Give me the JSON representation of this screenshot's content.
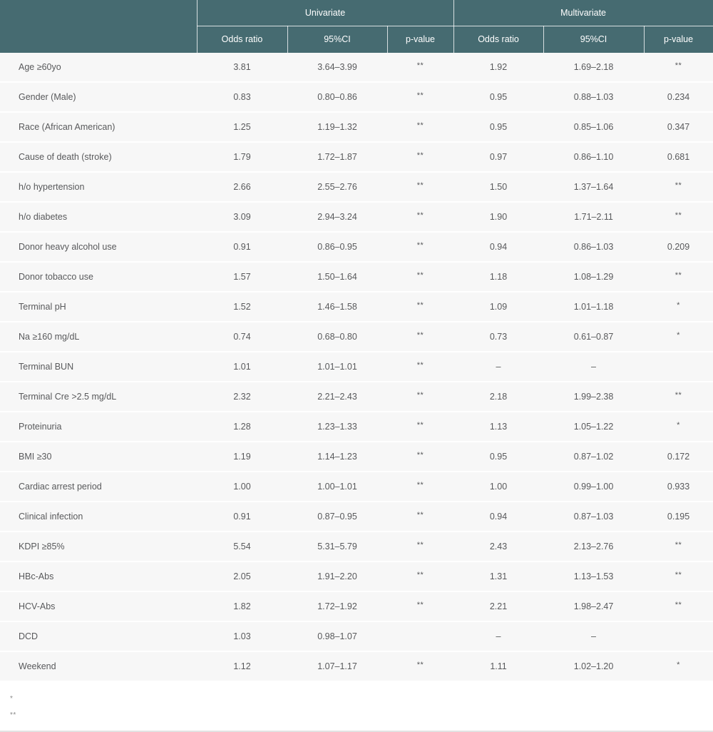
{
  "table": {
    "header": {
      "row_label_col": "",
      "groups": [
        {
          "label": "Univariate",
          "span": 3
        },
        {
          "label": "Multivariate",
          "span": 3
        }
      ],
      "subheaders": [
        "Odds ratio",
        "95%CI",
        "p-value",
        "Odds ratio",
        "95%CI",
        "p-value"
      ]
    },
    "rows": [
      {
        "label": "Age ≥60yo",
        "uni_or": "3.81",
        "uni_ci": "3.64–3.99",
        "uni_p": "**",
        "multi_or": "1.92",
        "multi_ci": "1.69–2.18",
        "multi_p": "**"
      },
      {
        "label": "Gender (Male)",
        "uni_or": "0.83",
        "uni_ci": "0.80–0.86",
        "uni_p": "**",
        "multi_or": "0.95",
        "multi_ci": "0.88–1.03",
        "multi_p": "0.234"
      },
      {
        "label": "Race (African American)",
        "uni_or": "1.25",
        "uni_ci": "1.19–1.32",
        "uni_p": "**",
        "multi_or": "0.95",
        "multi_ci": "0.85–1.06",
        "multi_p": "0.347"
      },
      {
        "label": "Cause of death (stroke)",
        "uni_or": "1.79",
        "uni_ci": "1.72–1.87",
        "uni_p": "**",
        "multi_or": "0.97",
        "multi_ci": "0.86–1.10",
        "multi_p": "0.681"
      },
      {
        "label": "h/o hypertension",
        "uni_or": "2.66",
        "uni_ci": "2.55–2.76",
        "uni_p": "**",
        "multi_or": "1.50",
        "multi_ci": "1.37–1.64",
        "multi_p": "**"
      },
      {
        "label": "h/o diabetes",
        "uni_or": "3.09",
        "uni_ci": "2.94–3.24",
        "uni_p": "**",
        "multi_or": "1.90",
        "multi_ci": "1.71–2.11",
        "multi_p": "**"
      },
      {
        "label": "Donor heavy alcohol use",
        "uni_or": "0.91",
        "uni_ci": "0.86–0.95",
        "uni_p": "**",
        "multi_or": "0.94",
        "multi_ci": "0.86–1.03",
        "multi_p": "0.209"
      },
      {
        "label": "Donor tobacco use",
        "uni_or": "1.57",
        "uni_ci": "1.50–1.64",
        "uni_p": "**",
        "multi_or": "1.18",
        "multi_ci": "1.08–1.29",
        "multi_p": "**"
      },
      {
        "label": "Terminal pH",
        "uni_or": "1.52",
        "uni_ci": "1.46–1.58",
        "uni_p": "**",
        "multi_or": "1.09",
        "multi_ci": "1.01–1.18",
        "multi_p": "*"
      },
      {
        "label": "Na ≥160 mg/dL",
        "uni_or": "0.74",
        "uni_ci": "0.68–0.80",
        "uni_p": "**",
        "multi_or": "0.73",
        "multi_ci": "0.61–0.87",
        "multi_p": "*"
      },
      {
        "label": "Terminal BUN",
        "uni_or": "1.01",
        "uni_ci": "1.01–1.01",
        "uni_p": "**",
        "multi_or": "–",
        "multi_ci": "–",
        "multi_p": ""
      },
      {
        "label": "Terminal Cre >2.5 mg/dL",
        "uni_or": "2.32",
        "uni_ci": "2.21–2.43",
        "uni_p": "**",
        "multi_or": "2.18",
        "multi_ci": "1.99–2.38",
        "multi_p": "**"
      },
      {
        "label": "Proteinuria",
        "uni_or": "1.28",
        "uni_ci": "1.23–1.33",
        "uni_p": "**",
        "multi_or": "1.13",
        "multi_ci": "1.05–1.22",
        "multi_p": "*"
      },
      {
        "label": "BMI ≥30",
        "uni_or": "1.19",
        "uni_ci": "1.14–1.23",
        "uni_p": "**",
        "multi_or": "0.95",
        "multi_ci": "0.87–1.02",
        "multi_p": "0.172"
      },
      {
        "label": "Cardiac arrest period",
        "uni_or": "1.00",
        "uni_ci": "1.00–1.01",
        "uni_p": "**",
        "multi_or": "1.00",
        "multi_ci": "0.99–1.00",
        "multi_p": "0.933"
      },
      {
        "label": "Clinical infection",
        "uni_or": "0.91",
        "uni_ci": "0.87–0.95",
        "uni_p": "**",
        "multi_or": "0.94",
        "multi_ci": "0.87–1.03",
        "multi_p": "0.195"
      },
      {
        "label": "KDPI ≥85%",
        "uni_or": "5.54",
        "uni_ci": "5.31–5.79",
        "uni_p": "**",
        "multi_or": "2.43",
        "multi_ci": "2.13–2.76",
        "multi_p": "**"
      },
      {
        "label": "HBc-Abs",
        "uni_or": "2.05",
        "uni_ci": "1.91–2.20",
        "uni_p": "**",
        "multi_or": "1.31",
        "multi_ci": "1.13–1.53",
        "multi_p": "**"
      },
      {
        "label": "HCV-Abs",
        "uni_or": "1.82",
        "uni_ci": "1.72–1.92",
        "uni_p": "**",
        "multi_or": "2.21",
        "multi_ci": "1.98–2.47",
        "multi_p": "**"
      },
      {
        "label": "DCD",
        "uni_or": "1.03",
        "uni_ci": "0.98–1.07",
        "uni_p": "",
        "multi_or": "–",
        "multi_ci": "–",
        "multi_p": ""
      },
      {
        "label": "Weekend",
        "uni_or": "1.12",
        "uni_ci": "1.07–1.17",
        "uni_p": "**",
        "multi_or": "1.11",
        "multi_ci": "1.02–1.20",
        "multi_p": "*"
      }
    ]
  },
  "footnotes": [
    {
      "marker": "*"
    },
    {
      "marker": "**"
    }
  ],
  "colors": {
    "header_teal": "#466B71",
    "row_background": "#F7F7F7",
    "body_text": "#58595B",
    "footnote_text": "#8A8A8A",
    "bottom_rule": "#E3E3E3"
  }
}
